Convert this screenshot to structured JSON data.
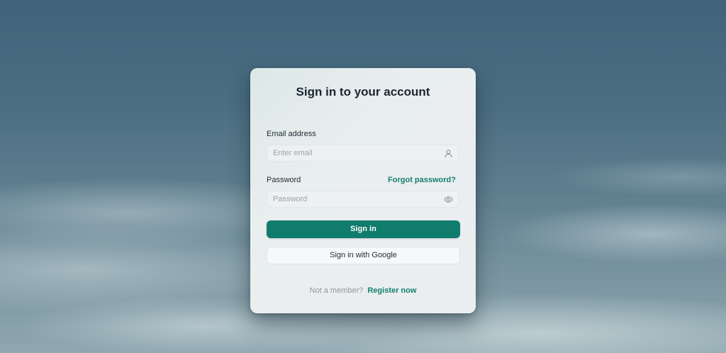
{
  "login": {
    "title": "Sign in to your account",
    "email": {
      "label": "Email address",
      "placeholder": "Enter email",
      "value": "",
      "icon": "user-icon"
    },
    "password": {
      "label": "Password",
      "placeholder": "Password",
      "value": "",
      "icon": "eye-icon",
      "forgot_label": "Forgot password?"
    },
    "sign_in_label": "Sign in",
    "google_label": "Sign in with Google",
    "footer": {
      "prompt": "Not a member?",
      "register_label": "Register now"
    }
  },
  "colors": {
    "accent": "#0f7c6c",
    "link": "#157f6e",
    "text": "#1d2630"
  }
}
